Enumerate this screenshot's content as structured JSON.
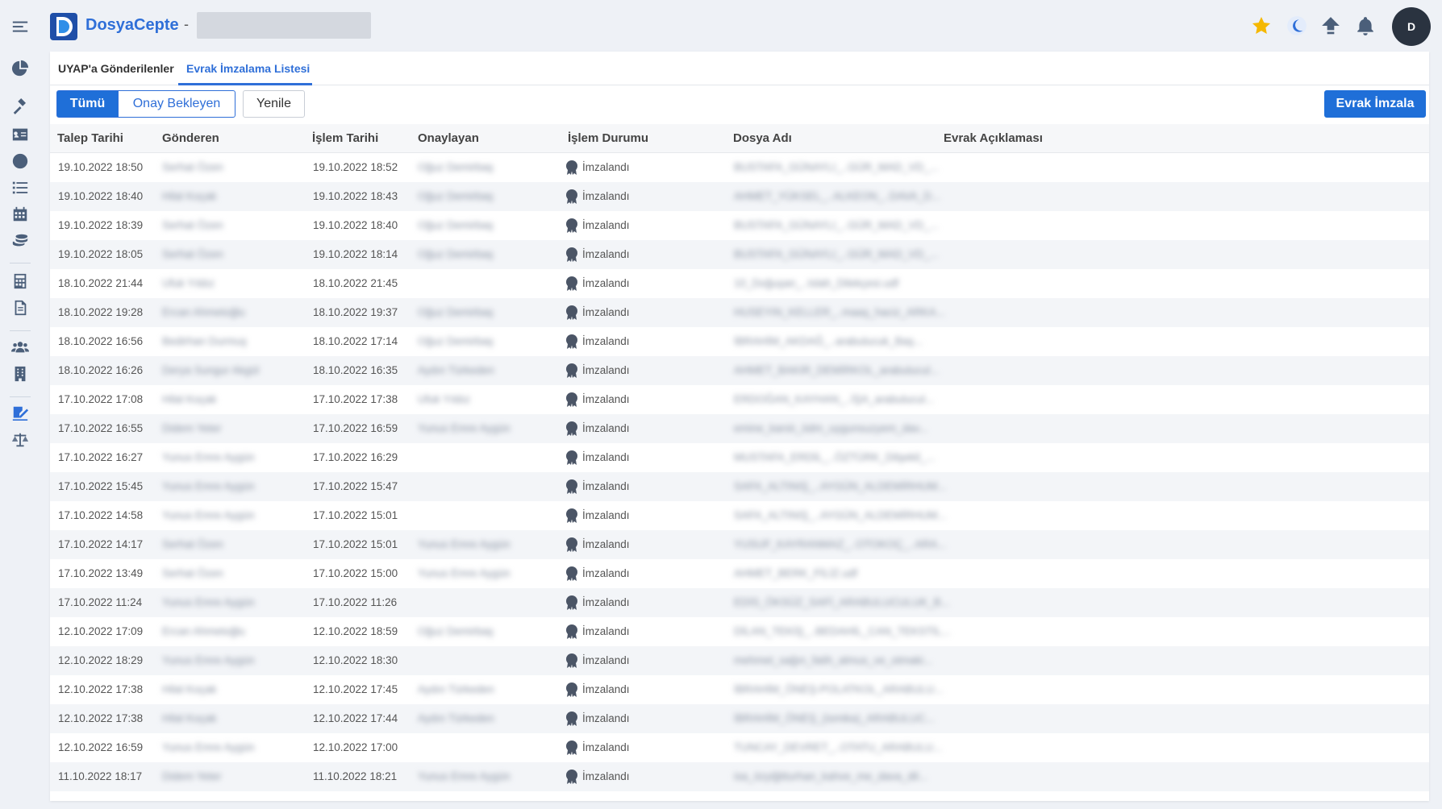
{
  "app": {
    "brand": "DosyaCepte",
    "separator": "-"
  },
  "tabs": [
    {
      "label": "UYAP'a Gönderilenler",
      "active": false
    },
    {
      "label": "Evrak İmzalama Listesi",
      "active": true
    }
  ],
  "toolbar": {
    "all_label": "Tümü",
    "pending_label": "Onay Bekleyen",
    "refresh_label": "Yenile",
    "sign_label": "Evrak İmzala"
  },
  "user": {
    "initial": "D"
  },
  "columns": [
    "Talep Tarihi",
    "Gönderen",
    "İşlem Tarihi",
    "Onaylayan",
    "İşlem Durumu",
    "Dosya Adı",
    "Evrak Açıklaması"
  ],
  "rows": [
    {
      "request": "19.10.2022 18:50",
      "sender": "Serhat Özen",
      "process": "19.10.2022 18:52",
      "approver": "Oğuz Demirbaş",
      "status": "İmzalandı",
      "file": "BUSTAFA_GÜNAYLI_..GÜR_MAD_VD_..."
    },
    {
      "request": "19.10.2022 18:40",
      "sender": "Hilal Koçak",
      "process": "19.10.2022 18:43",
      "approver": "Oğuz Demirbaş",
      "status": "İmzalandı",
      "file": "AHMET_YÜKSEL_..ALKEON_..DAVA_D..."
    },
    {
      "request": "19.10.2022 18:39",
      "sender": "Serhat Özen",
      "process": "19.10.2022 18:40",
      "approver": "Oğuz Demirbaş",
      "status": "İmzalandı",
      "file": "BUSTAFA_GÜNAYLI_..GÜR_MAD_VD_..."
    },
    {
      "request": "19.10.2022 18:05",
      "sender": "Serhat Özen",
      "process": "19.10.2022 18:14",
      "approver": "Oğuz Demirbaş",
      "status": "İmzalandı",
      "file": "BUSTAFA_GÜNAYLI_..GÜR_MAD_VD_..."
    },
    {
      "request": "18.10.2022 21:44",
      "sender": "Ufuk Yıldız",
      "process": "18.10.2022 21:45",
      "approver": "",
      "status": "İmzalandı",
      "file": "10_Doğuşan_..Islah_Dilekçesi.udf"
    },
    {
      "request": "18.10.2022 19:28",
      "sender": "Ercan Ahmetoğlu",
      "process": "18.10.2022 19:37",
      "approver": "Oğuz Demirbaş",
      "status": "İmzalandı",
      "file": "HUSEYIN_KELLER_..maaş_haciz_ARKA..."
    },
    {
      "request": "18.10.2022 16:56",
      "sender": "Bedirhan Durmuş",
      "process": "18.10.2022 17:14",
      "approver": "Oğuz Demirbaş",
      "status": "İmzalandı",
      "file": "İBRAHİM_AKDAĞ_..arabulucuk_Baş..."
    },
    {
      "request": "18.10.2022 16:26",
      "sender": "Derya Sungur Akgül",
      "process": "18.10.2022 16:35",
      "approver": "Aydın Türkeden",
      "status": "İmzalandı",
      "file": "AHMET_BAKIR_DEMİRKOL_arabulucul..."
    },
    {
      "request": "17.10.2022 17:08",
      "sender": "Hilal Koçak",
      "process": "17.10.2022 17:38",
      "approver": "Ufuk Yıldız",
      "status": "İmzalandı",
      "file": "ERDOĞAN_KAYHAN_..İŞA_arabulucul..."
    },
    {
      "request": "17.10.2022 16:55",
      "sender": "Didem Yeter",
      "process": "17.10.2022 16:59",
      "approver": "Yunus Emre Aygün",
      "status": "İmzalandı",
      "file": "emine_karslı_ödm_uygunsuzyem_dav..."
    },
    {
      "request": "17.10.2022 16:27",
      "sender": "Yunus Emre Aygün",
      "process": "17.10.2022 16:29",
      "approver": "",
      "status": "İmzalandı",
      "file": "MUSTAFA_ERDİL_..ÖZTÜRK_Dilşekil_..."
    },
    {
      "request": "17.10.2022 15:45",
      "sender": "Yunus Emre Aygün",
      "process": "17.10.2022 15:47",
      "approver": "",
      "status": "İmzalandı",
      "file": "SAFA_ALTINIŞ_..AYGÜN_ALDEMİRHUM..."
    },
    {
      "request": "17.10.2022 14:58",
      "sender": "Yunus Emre Aygün",
      "process": "17.10.2022 15:01",
      "approver": "",
      "status": "İmzalandı",
      "file": "SAFA_ALTINIŞ_..AYGÜN_ALDEMİRHUM..."
    },
    {
      "request": "17.10.2022 14:17",
      "sender": "Serhat Özen",
      "process": "17.10.2022 15:01",
      "approver": "Yunus Emre Aygün",
      "status": "İmzalandı",
      "file": "YUSUF_KAYRANMAZ_..OTOKOÇ_..ARA..."
    },
    {
      "request": "17.10.2022 13:49",
      "sender": "Serhat Özen",
      "process": "17.10.2022 15:00",
      "approver": "Yunus Emre Aygün",
      "status": "İmzalandı",
      "file": "AHMET_BERK_FİLİZ.udf"
    },
    {
      "request": "17.10.2022 11:24",
      "sender": "Yunus Emre Aygün",
      "process": "17.10.2022 11:26",
      "approver": "",
      "status": "İmzalandı",
      "file": "EDİS_ÖKSÜZ_SAFİ_ARABULUCULUK_B..."
    },
    {
      "request": "12.10.2022 17:09",
      "sender": "Ercan Ahmetoğlu",
      "process": "12.10.2022 18:59",
      "approver": "Oğuz Demirbaş",
      "status": "İmzalandı",
      "file": "DİLAN_TEKİŞ_..BEDAHİL_CAN_TEKSTİL..."
    },
    {
      "request": "12.10.2022 18:29",
      "sender": "Yunus Emre Aygün",
      "process": "12.10.2022 18:30",
      "approver": "",
      "status": "İmzalandı",
      "file": "mehmet_sağın_fatih_almus_ve_otmaki..."
    },
    {
      "request": "12.10.2022 17:38",
      "sender": "Hilal Koçak",
      "process": "12.10.2022 17:45",
      "approver": "Aydın Türkeden",
      "status": "İmzalandı",
      "file": "İBRAHİM_ÖNEŞ-POLATKOL_ARABULU..."
    },
    {
      "request": "12.10.2022 17:38",
      "sender": "Hilal Koçak",
      "process": "12.10.2022 17:44",
      "approver": "Aydın Türkeden",
      "status": "İmzalandı",
      "file": "İBRAHİM_ÖNEŞ_(ismika)_ARABULUC..."
    },
    {
      "request": "12.10.2022 16:59",
      "sender": "Yunus Emre Aygün",
      "process": "12.10.2022 17:00",
      "approver": "",
      "status": "İmzalandı",
      "file": "TUNCAY_DEVRET_..OTATU_ARABULU..."
    },
    {
      "request": "11.10.2022 18:17",
      "sender": "Didem Yeter",
      "process": "11.10.2022 18:21",
      "approver": "Yunus Emre Aygün",
      "status": "İmzalandı",
      "file": "isa_özyiğitturhan_kahve_me_dava_dil..."
    }
  ]
}
